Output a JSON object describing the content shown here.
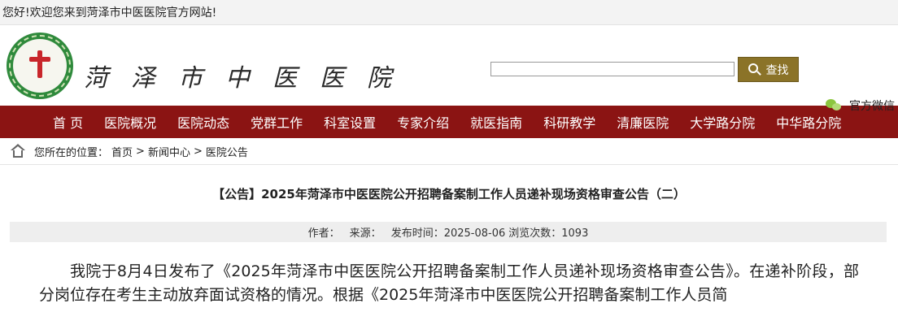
{
  "topbar": {
    "welcome": "您好!欢迎您来到菏泽市中医医院官方网站!"
  },
  "header": {
    "hospital_name": "菏泽市中医医院",
    "search": {
      "placeholder": "",
      "button_label": "查找"
    },
    "wechat_label": "官方微信"
  },
  "nav": {
    "items": [
      {
        "label": "首 页"
      },
      {
        "label": "医院概况"
      },
      {
        "label": "医院动态"
      },
      {
        "label": "党群工作"
      },
      {
        "label": "科室设置"
      },
      {
        "label": "专家介绍"
      },
      {
        "label": "就医指南"
      },
      {
        "label": "科研教学"
      },
      {
        "label": "清廉医院"
      },
      {
        "label": "大学路分院"
      },
      {
        "label": "中华路分院"
      }
    ]
  },
  "breadcrumb": {
    "prefix": "您所在的位置：",
    "items": [
      "首页",
      "新闻中心",
      "医院公告"
    ],
    "separator": ">"
  },
  "article": {
    "title": "【公告】2025年菏泽市中医医院公开招聘备案制工作人员递补现场资格审查公告（二）",
    "meta": {
      "author": "作者：",
      "source": "来源：",
      "date": "发布时间：2025-08-06",
      "views": "浏览次数：1093"
    },
    "paragraph": "我院于8月4日发布了《2025年菏泽市中医医院公开招聘备案制工作人员递补现场资格审查公告》。在递补阶段，部分岗位存在考生主动放弃面试资格的情况。根据《2025年菏泽市中医医院公开招聘备案制工作人员简"
  }
}
